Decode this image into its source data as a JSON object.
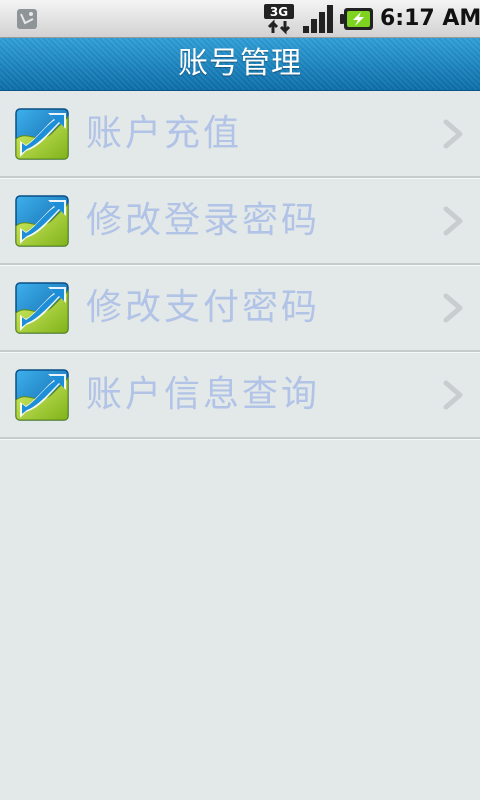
{
  "status_bar": {
    "time": "6:17 AM",
    "network_icon": "3g-arrows-icon",
    "signal_icon": "signal-strength-icon",
    "battery_icon": "battery-charging-icon",
    "notification_icon": "notification-icon"
  },
  "header": {
    "title": "账号管理"
  },
  "menu": {
    "items": [
      {
        "label": "账户充值",
        "icon": "app-logo-icon",
        "chevron": "chevron-right-icon"
      },
      {
        "label": "修改登录密码",
        "icon": "app-logo-icon",
        "chevron": "chevron-right-icon"
      },
      {
        "label": "修改支付密码",
        "icon": "app-logo-icon",
        "chevron": "chevron-right-icon"
      },
      {
        "label": "账户信息查询",
        "icon": "app-logo-icon",
        "chevron": "chevron-right-icon"
      }
    ]
  },
  "colors": {
    "title_bar": "#1a82c0",
    "label_text": "#b1c3e6",
    "background": "#e3e8e8",
    "icon_blue": "#1c86d0",
    "icon_green": "#9ccc2a"
  }
}
